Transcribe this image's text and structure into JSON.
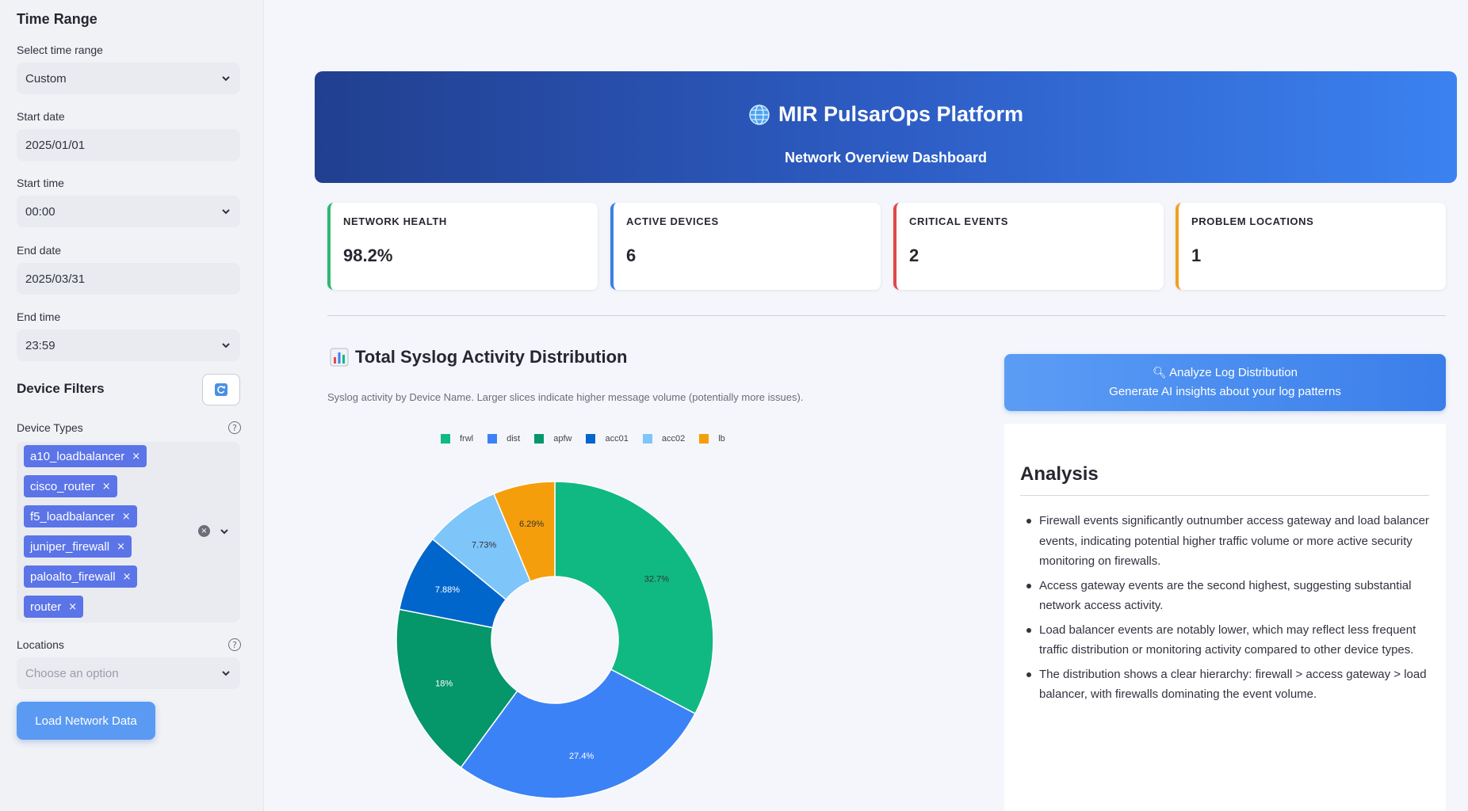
{
  "sidebar": {
    "time_range_heading": "Time Range",
    "select_label": "Select time range",
    "select_value": "Custom",
    "start_date_label": "Start date",
    "start_date_value": "2025/01/01",
    "start_time_label": "Start time",
    "start_time_value": "00:00",
    "end_date_label": "End date",
    "end_date_value": "2025/03/31",
    "end_time_label": "End time",
    "end_time_value": "23:59",
    "device_filters_heading": "Device Filters",
    "device_types_label": "Device Types",
    "device_types": [
      "a10_loadbalancer",
      "cisco_router",
      "f5_loadbalancer",
      "juniper_firewall",
      "paloalto_firewall",
      "router"
    ],
    "locations_label": "Locations",
    "locations_placeholder": "Choose an option",
    "load_button": "Load Network Data",
    "chip_remove_glyph": "×",
    "help_glyph": "?"
  },
  "banner": {
    "title": "MIR PulsarOps Platform",
    "subtitle": "Network Overview Dashboard"
  },
  "kpis": [
    {
      "label": "NETWORK HEALTH",
      "value": "98.2%",
      "color": "#2eb872"
    },
    {
      "label": "ACTIVE DEVICES",
      "value": "6",
      "color": "#3b7eea"
    },
    {
      "label": "CRITICAL EVENTS",
      "value": "2",
      "color": "#e04848"
    },
    {
      "label": "PROBLEM LOCATIONS",
      "value": "1",
      "color": "#f0a020"
    }
  ],
  "syslog": {
    "title": "Total Syslog Activity Distribution",
    "description": "Syslog activity by Device Name. Larger slices indicate higher message volume (potentially more issues)."
  },
  "chart_data": {
    "type": "pie",
    "hole": true,
    "legend_position": "top",
    "categories": [
      "frwl",
      "dist",
      "apfw",
      "acc01",
      "acc02",
      "lb"
    ],
    "values": [
      32.7,
      27.4,
      18,
      7.88,
      7.73,
      6.29
    ],
    "labels": [
      "32.7%",
      "27.4%",
      "18%",
      "7.88%",
      "7.73%",
      "6.29%"
    ],
    "colors": [
      "#10b981",
      "#3b82f6",
      "#059669",
      "#0066cc",
      "#7ec5fa",
      "#f59e0b"
    ]
  },
  "analyze": {
    "line1": "Analyze Log Distribution",
    "line2": "Generate AI insights about your log patterns"
  },
  "analysis": {
    "title": "Analysis",
    "bullets": [
      "Firewall events significantly outnumber access gateway and load balancer events, indicating potential higher traffic volume or more active security monitoring on firewalls.",
      "Access gateway events are the second highest, suggesting substantial network access activity.",
      "Load balancer events are notably lower, which may reflect less frequent traffic distribution or monitoring activity compared to other device types.",
      "The distribution shows a clear hierarchy: firewall > access gateway > load balancer, with firewalls dominating the event volume."
    ]
  }
}
